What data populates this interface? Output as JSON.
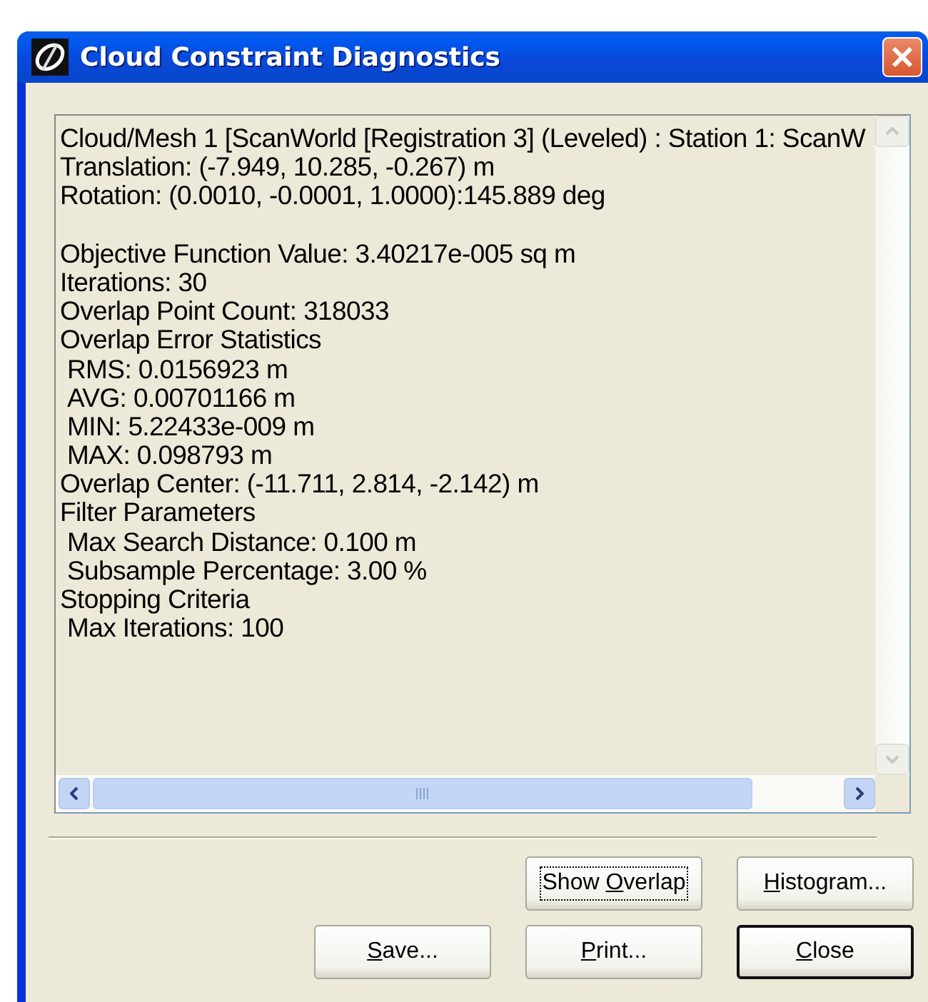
{
  "window": {
    "title": "Cloud Constraint Diagnostics"
  },
  "report": {
    "lines": [
      {
        "text": "Cloud/Mesh 1  [ScanWorld [Registration 3] (Leveled) : Station 1: ScanW",
        "indent": false,
        "gap_before": false
      },
      {
        "text": "Translation: (-7.949, 10.285, -0.267) m",
        "indent": false,
        "gap_before": false
      },
      {
        "text": "Rotation: (0.0010, -0.0001, 1.0000):145.889 deg",
        "indent": false,
        "gap_before": false
      },
      {
        "text": "Objective Function Value: 3.40217e-005 sq m",
        "indent": false,
        "gap_before": true
      },
      {
        "text": "Iterations: 30",
        "indent": false,
        "gap_before": false
      },
      {
        "text": "Overlap Point Count: 318033",
        "indent": false,
        "gap_before": false
      },
      {
        "text": "Overlap Error Statistics",
        "indent": false,
        "gap_before": false
      },
      {
        "text": "RMS: 0.0156923 m",
        "indent": true,
        "gap_before": false
      },
      {
        "text": "AVG: 0.00701166 m",
        "indent": true,
        "gap_before": false
      },
      {
        "text": "MIN: 5.22433e-009 m",
        "indent": true,
        "gap_before": false
      },
      {
        "text": "MAX: 0.098793 m",
        "indent": true,
        "gap_before": false
      },
      {
        "text": "Overlap Center: (-11.711, 2.814, -2.142) m",
        "indent": false,
        "gap_before": false
      },
      {
        "text": "Filter Parameters",
        "indent": false,
        "gap_before": false
      },
      {
        "text": "Max Search Distance: 0.100 m",
        "indent": true,
        "gap_before": false
      },
      {
        "text": "Subsample Percentage: 3.00 %",
        "indent": true,
        "gap_before": false
      },
      {
        "text": "Stopping Criteria",
        "indent": false,
        "gap_before": false
      },
      {
        "text": "Max Iterations: 100",
        "indent": true,
        "gap_before": false
      }
    ]
  },
  "button_rows": [
    [
      {
        "text_before": "Show ",
        "access_key": "O",
        "text_after": "verlap",
        "focused": true,
        "default": false
      },
      {
        "access_key": "H",
        "text_after": "istogram...",
        "focused": false,
        "default": false
      }
    ],
    [
      {
        "access_key": "S",
        "text_after": "ave...",
        "focused": false,
        "default": false
      },
      {
        "access_key": "P",
        "text_after": "rint...",
        "focused": false,
        "default": false
      },
      {
        "access_key": "C",
        "text_after": "lose",
        "focused": false,
        "default": true
      }
    ]
  ]
}
